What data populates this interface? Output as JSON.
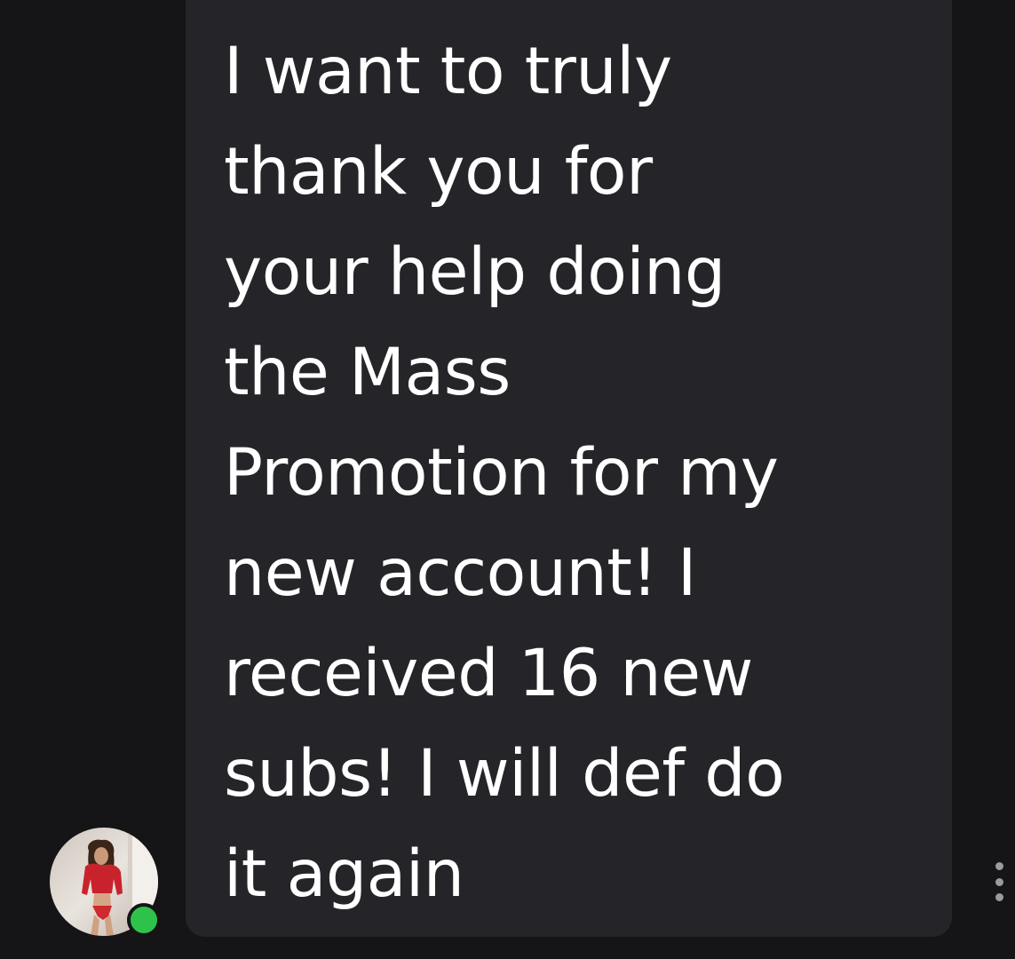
{
  "colors": {
    "background": "#151517",
    "bubble": "#252529",
    "text": "#ffffff",
    "online_indicator": "#2fc24a",
    "more_dots": "#9a9aa0"
  },
  "message": {
    "lines": [
      "I want to truly",
      "thank you for",
      "your help doing",
      "the Mass",
      "Promotion for my",
      "new account! I",
      "received 16 new",
      "subs! I will def do",
      "it again"
    ]
  },
  "sender": {
    "avatar_icon": "user-photo-avatar",
    "online": true
  },
  "actions": {
    "more_icon": "more-vertical-icon"
  }
}
